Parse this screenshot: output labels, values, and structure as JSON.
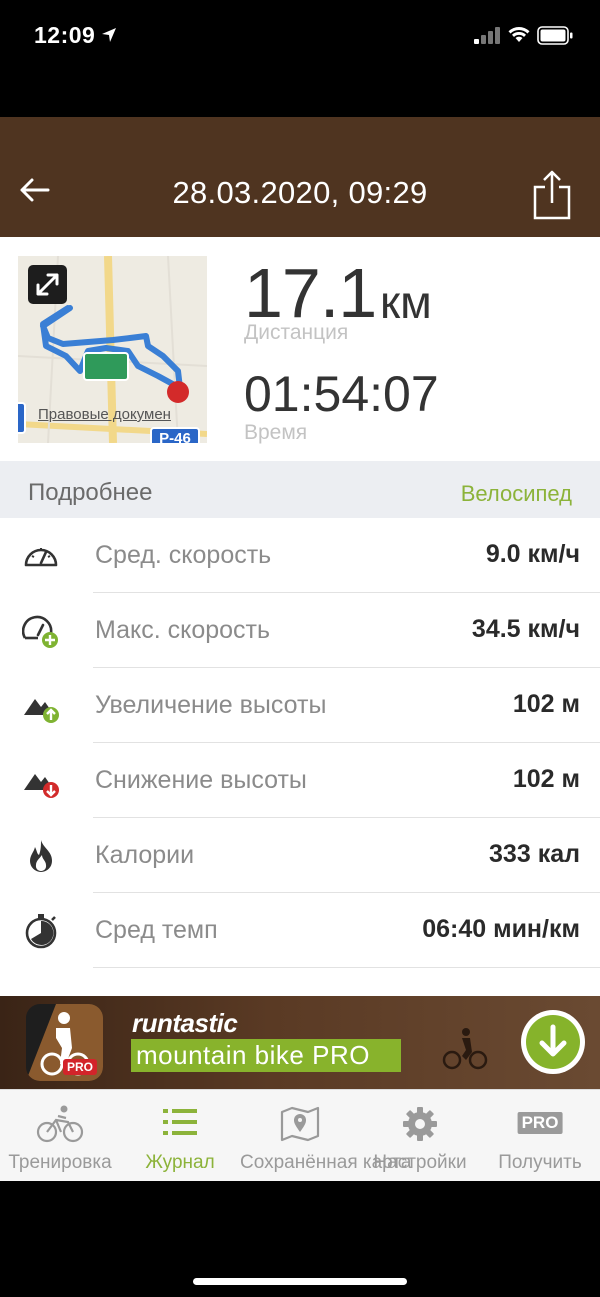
{
  "status_bar": {
    "time": "12:09"
  },
  "header": {
    "title": "28.03.2020, 09:29",
    "back_icon": "back-arrow-icon",
    "share_icon": "share-icon"
  },
  "summary": {
    "distance_value": "17.1",
    "distance_unit": "км",
    "distance_label": "Дистанция",
    "time_value": "01:54:07",
    "time_label": "Время",
    "map": {
      "watermark": "Правовые докумен",
      "road_badge": "Р-46"
    }
  },
  "details": {
    "label": "Подробнее",
    "sport": "Велосипед"
  },
  "stats": [
    {
      "icon": "speedometer-icon",
      "name": "Сред. скорость",
      "value": "9.0 км/ч"
    },
    {
      "icon": "max-speed-icon",
      "name": "Макс. скорость",
      "value": "34.5 км/ч"
    },
    {
      "icon": "elevation-gain-icon",
      "name": "Увеличение высоты",
      "value": "102 м"
    },
    {
      "icon": "elevation-loss-icon",
      "name": "Снижение высоты",
      "value": "102 м"
    },
    {
      "icon": "flame-icon",
      "name": "Калории",
      "value": "333 кал"
    },
    {
      "icon": "stopwatch-icon",
      "name": "Сред темп",
      "value": "06:40 мин/км"
    }
  ],
  "banner": {
    "brand": "runtastic",
    "tagline": "mountain bike PRO",
    "badge": "PRO"
  },
  "tabs": [
    {
      "label": "Тренировка",
      "icon": "bike-icon",
      "active": false
    },
    {
      "label": "Журнал",
      "icon": "list-icon",
      "active": true
    },
    {
      "label": "Сохранённая карта",
      "icon": "map-icon",
      "active": false
    },
    {
      "label": "Настройки",
      "icon": "gear-icon",
      "active": false
    },
    {
      "label": "Получить",
      "icon": "pro-badge-icon",
      "badge": "PRO",
      "active": false
    }
  ],
  "colors": {
    "header_bg": "#4f3420",
    "accent_green": "#8cb33a",
    "route_blue": "#3a7fd5",
    "end_marker_red": "#d32a2a"
  }
}
